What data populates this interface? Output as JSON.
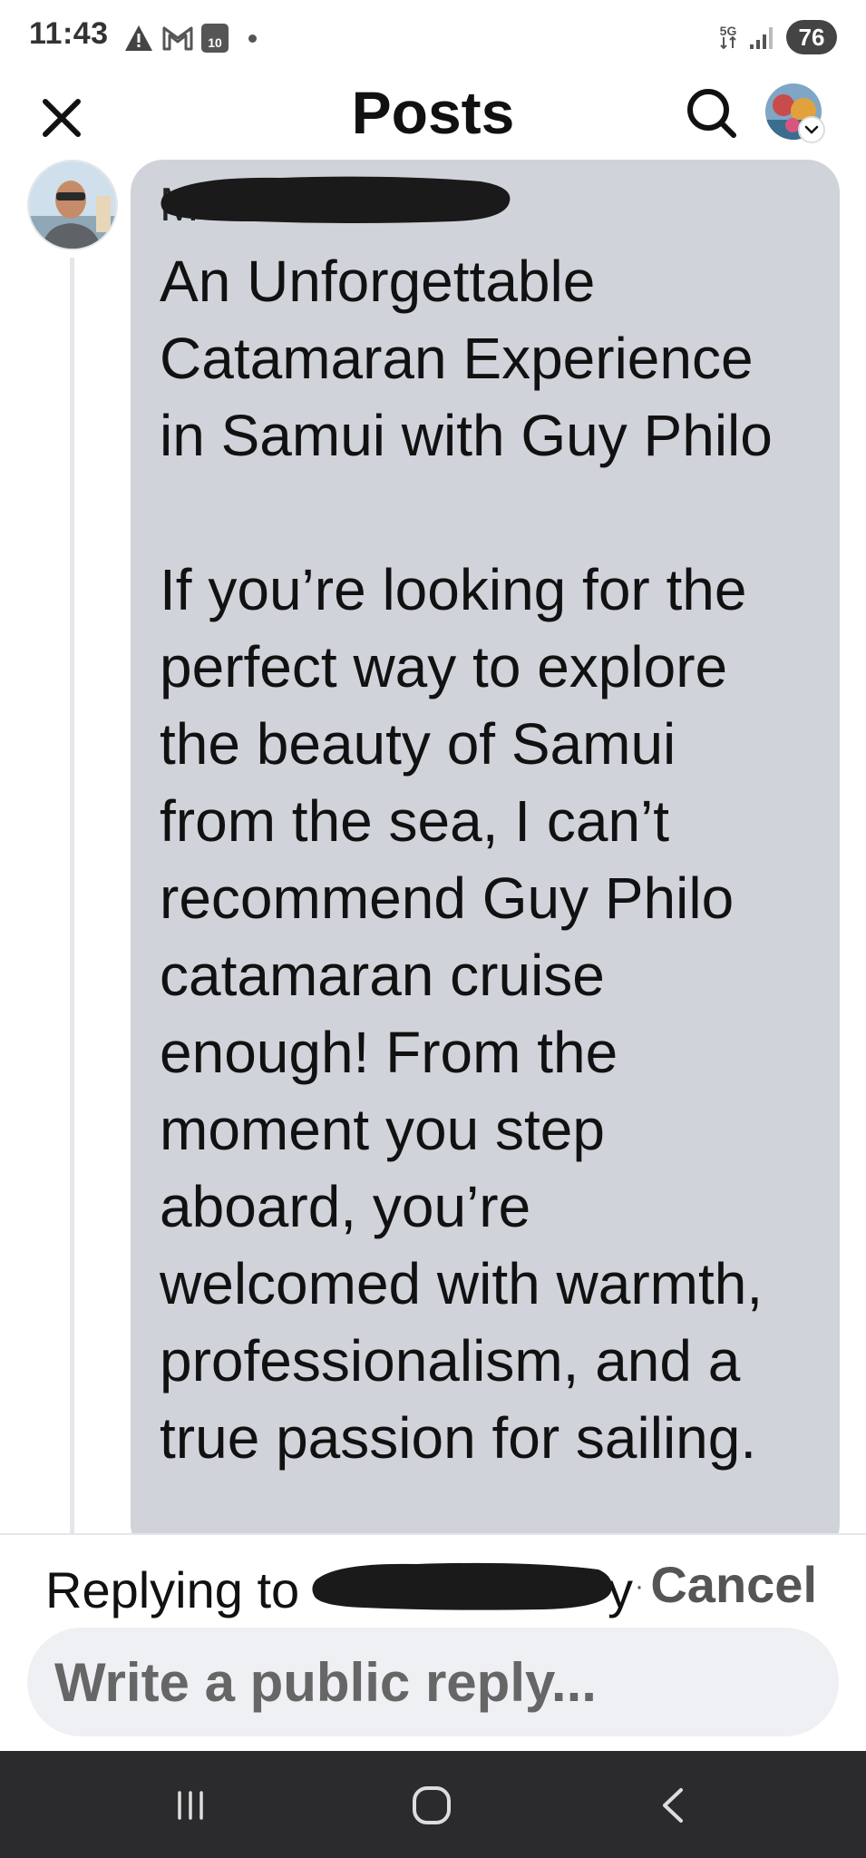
{
  "status_bar": {
    "time": "11:43",
    "calendar_day": "10",
    "network_label": "5G",
    "battery": "76"
  },
  "header": {
    "title": "Posts"
  },
  "comment": {
    "author_name": "M",
    "text": "An Unforgettable\nCatamaran Experience\nin Samui with Guy Philo\n\nIf you’re looking for the\nperfect way to explore\nthe beauty of Samui\nfrom the sea, I can’t\nrecommend Guy Philo\ncatamaran cruise\nenough! From the\nmoment you step\naboard, you’re\nwelcomed with warmth,\nprofessionalism, and a\ntrue passion for sailing."
  },
  "reply": {
    "replying_to_label": "Replying to",
    "replying_to_tail": "y",
    "separator": "·",
    "cancel_label": "Cancel",
    "placeholder": "Write a public reply..."
  },
  "colors": {
    "bubble": "#d0d3d9",
    "input_bg": "#eff0f3",
    "nav_bar": "#2b2b2d",
    "redaction": "#1a1a1a"
  }
}
